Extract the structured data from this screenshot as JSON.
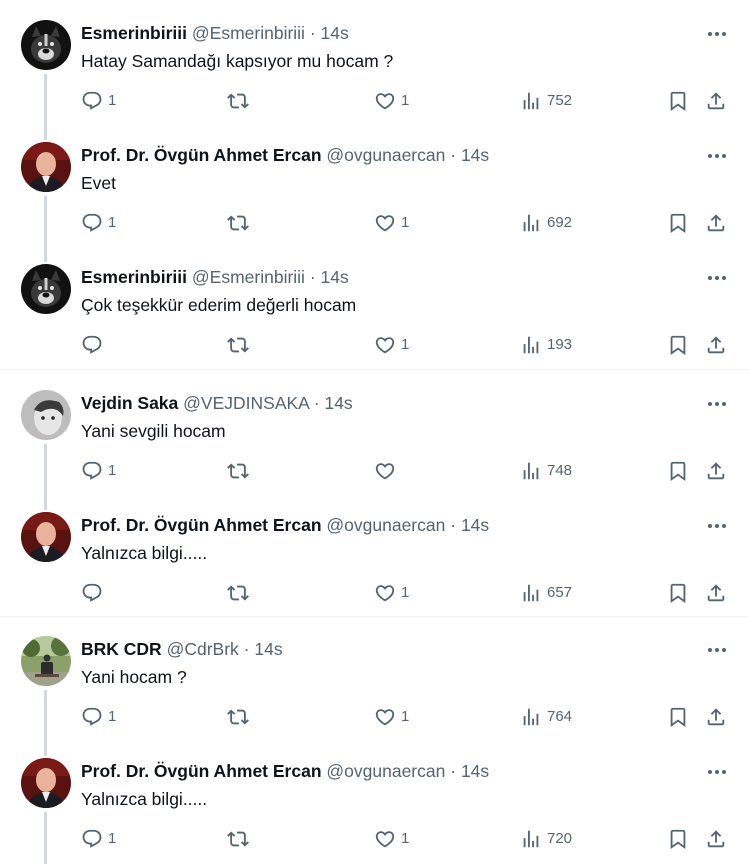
{
  "colors": {
    "text": "#0f1419",
    "secondary": "#536471",
    "thread_line": "#cfd9de",
    "divider": "#eff3f4"
  },
  "icons": [
    "reply-icon",
    "retweet-icon",
    "like-icon",
    "views-icon",
    "bookmark-icon",
    "share-icon",
    "more-icon"
  ],
  "tweets": [
    {
      "name": "Esmerinbiriii",
      "handle": "@Esmerinbiriii",
      "dot": "·",
      "time": "14s",
      "text": "Hatay Samandağı kapsıyor mu hocam ?",
      "replies": "1",
      "retweets": "",
      "likes": "1",
      "views": "752",
      "avatar": "dog"
    },
    {
      "name": "Prof. Dr. Övgün Ahmet Ercan",
      "handle": "@ovgunaercan",
      "dot": "·",
      "time": "14s",
      "text": "Evet",
      "replies": "1",
      "retweets": "",
      "likes": "1",
      "views": "692",
      "avatar": "prof"
    },
    {
      "name": "Esmerinbiriii",
      "handle": "@Esmerinbiriii",
      "dot": "·",
      "time": "14s",
      "text": "Çok teşekkür ederim değerli hocam",
      "replies": "",
      "retweets": "",
      "likes": "1",
      "views": "193",
      "avatar": "dog"
    },
    {
      "name": "Vejdin Saka",
      "handle": "@VEJDINSAKA",
      "dot": "·",
      "time": "14s",
      "text": "Yani sevgili hocam",
      "replies": "1",
      "retweets": "",
      "likes": "",
      "views": "748",
      "avatar": "child"
    },
    {
      "name": "Prof. Dr. Övgün Ahmet Ercan",
      "handle": "@ovgunaercan",
      "dot": "·",
      "time": "14s",
      "text": "Yalnızca bilgi.....",
      "replies": "",
      "retweets": "",
      "likes": "1",
      "views": "657",
      "avatar": "prof"
    },
    {
      "name": "BRK CDR",
      "handle": "@CdrBrk",
      "dot": "·",
      "time": "14s",
      "text": "Yani hocam ?",
      "replies": "1",
      "retweets": "",
      "likes": "1",
      "views": "764",
      "avatar": "park"
    },
    {
      "name": "Prof. Dr. Övgün Ahmet Ercan",
      "handle": "@ovgunaercan",
      "dot": "·",
      "time": "14s",
      "text": "Yalnızca bilgi.....",
      "replies": "1",
      "retweets": "",
      "likes": "1",
      "views": "720",
      "avatar": "prof"
    }
  ]
}
